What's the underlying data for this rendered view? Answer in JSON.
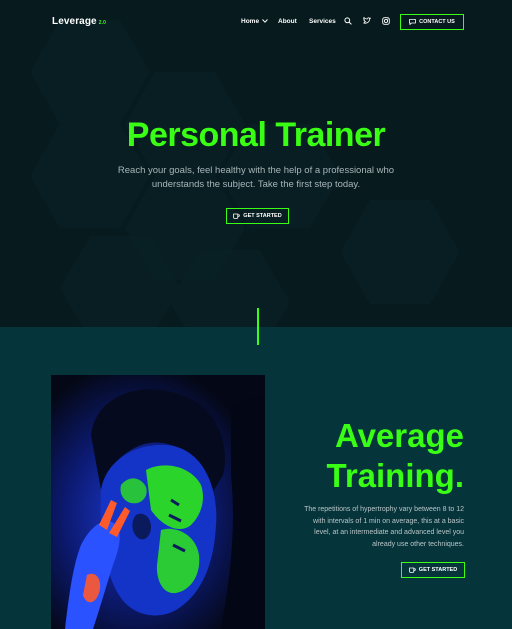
{
  "colors": {
    "accent": "#39ff14",
    "hero_bg": "#071a1e",
    "section_bg": "#06343b"
  },
  "nav": {
    "logo": "Leverage",
    "logo_version": "2.0",
    "items": [
      {
        "label": "Home",
        "has_dropdown": true
      },
      {
        "label": "About",
        "has_dropdown": false
      },
      {
        "label": "Services",
        "has_dropdown": false
      }
    ],
    "icons": [
      "search-icon",
      "twitter-icon",
      "instagram-icon"
    ],
    "contact_label": "CONTACT US",
    "contact_icon": "chat-icon"
  },
  "hero": {
    "title": "Personal Trainer",
    "subtitle_line1": "Reach your goals, feel healthy with the help of a professional who",
    "subtitle_line2": "understands the subject. Take the first step today.",
    "button_label": "GET STARTED",
    "button_icon": "coffee-icon"
  },
  "training": {
    "title_line1": "Average",
    "title_line2": "Training.",
    "text_line1": "The repetitions of hypertrophy vary between 8 to 12",
    "text_line2": "with intervals of 1 min on average, this at a basic",
    "text_line3": "level, at an intermediate and advanced level you",
    "text_line4": "already use other techniques.",
    "button_label": "GET STARTED",
    "button_icon": "coffee-icon"
  }
}
